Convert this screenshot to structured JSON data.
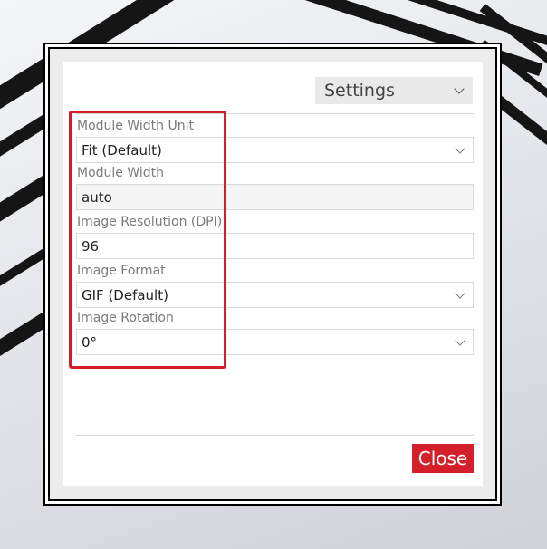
{
  "header": {
    "settings_label": "Settings"
  },
  "fields": [
    {
      "label": "Module Width Unit",
      "value": "Fit (Default)",
      "type": "select"
    },
    {
      "label": "Module Width",
      "value": "auto",
      "type": "readonly"
    },
    {
      "label": "Image Resolution (DPI)",
      "value": "96",
      "type": "input"
    },
    {
      "label": "Image Format",
      "value": "GIF (Default)",
      "type": "select"
    },
    {
      "label": "Image Rotation",
      "value": "0°",
      "type": "select"
    }
  ],
  "footer": {
    "close_label": "Close"
  },
  "colors": {
    "accent": "#d4202b",
    "highlight": "#d21f2a"
  }
}
